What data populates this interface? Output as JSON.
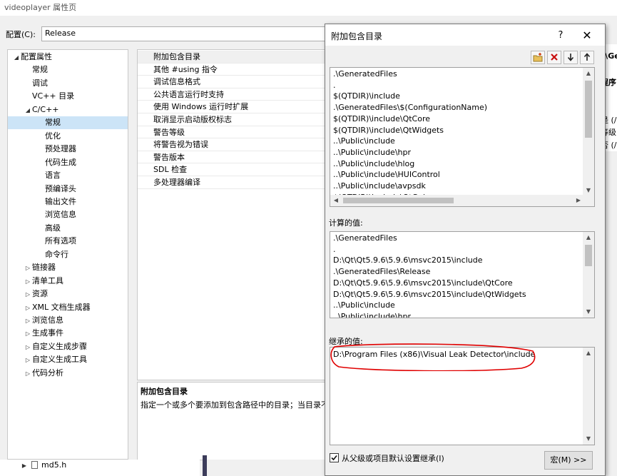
{
  "window": {
    "title": "videoplayer 属性页"
  },
  "config": {
    "label": "配置(C):",
    "value": "Release"
  },
  "tree": {
    "items": [
      {
        "label": "配置属性",
        "level": 0,
        "arrow": "down"
      },
      {
        "label": "常规",
        "level": 1
      },
      {
        "label": "调试",
        "level": 1
      },
      {
        "label": "VC++ 目录",
        "level": 1
      },
      {
        "label": "C/C++",
        "level": 1,
        "arrow": "down"
      },
      {
        "label": "常规",
        "level": 2,
        "selected": true
      },
      {
        "label": "优化",
        "level": 2
      },
      {
        "label": "预处理器",
        "level": 2
      },
      {
        "label": "代码生成",
        "level": 2
      },
      {
        "label": "语言",
        "level": 2
      },
      {
        "label": "预编译头",
        "level": 2
      },
      {
        "label": "输出文件",
        "level": 2
      },
      {
        "label": "浏览信息",
        "level": 2
      },
      {
        "label": "高级",
        "level": 2
      },
      {
        "label": "所有选项",
        "level": 2
      },
      {
        "label": "命令行",
        "level": 2
      },
      {
        "label": "链接器",
        "level": 1,
        "arrow": "right"
      },
      {
        "label": "清单工具",
        "level": 1,
        "arrow": "right"
      },
      {
        "label": "资源",
        "level": 1,
        "arrow": "right"
      },
      {
        "label": "XML 文档生成器",
        "level": 1,
        "arrow": "right"
      },
      {
        "label": "浏览信息",
        "level": 1,
        "arrow": "right"
      },
      {
        "label": "生成事件",
        "level": 1,
        "arrow": "right"
      },
      {
        "label": "自定义生成步骤",
        "level": 1,
        "arrow": "right"
      },
      {
        "label": "自定义生成工具",
        "level": 1,
        "arrow": "right"
      },
      {
        "label": "代码分析",
        "level": 1,
        "arrow": "right"
      }
    ]
  },
  "properties": [
    "附加包含目录",
    "其他 #using 指令",
    "调试信息格式",
    "公共语言运行时支持",
    "使用 Windows 运行时扩展",
    "取消显示启动版权标志",
    "警告等级",
    "将警告视为错误",
    "警告版本",
    "SDL 检查",
    "多处理器编译"
  ],
  "description": {
    "title": "附加包含目录",
    "text": "指定一个或多个要添加到包含路径中的目录；当目录不"
  },
  "right_fragments": {
    "header": ".\\Ge",
    "line1": "程序",
    "line2": "是 (/",
    "line3": "等级",
    "line4": "否 (/"
  },
  "solution": {
    "file": "md5.h"
  },
  "dialog": {
    "title": "附加包含目录",
    "help_label": "?",
    "close_label": "✕",
    "directories": [
      ".\\GeneratedFiles",
      ".",
      "$(QTDIR)\\include",
      ".\\GeneratedFiles\\$(ConfigurationName)",
      "$(QTDIR)\\include\\QtCore",
      "$(QTDIR)\\include\\QtWidgets",
      "..\\Public\\include",
      "..\\Public\\include\\hpr",
      "..\\Public\\include\\hlog",
      "..\\Public\\include\\HUIControl",
      "..\\Public\\include\\avpsdk",
      "$(QTDIR)\\include\\QtGui"
    ],
    "computed_label": "计算的值:",
    "computed": [
      ".\\GeneratedFiles",
      ".",
      "D:\\Qt\\Qt5.9.6\\5.9.6\\msvc2015\\include",
      ".\\GeneratedFiles\\Release",
      "D:\\Qt\\Qt5.9.6\\5.9.6\\msvc2015\\include\\QtCore",
      "D:\\Qt\\Qt5.9.6\\5.9.6\\msvc2015\\include\\QtWidgets",
      "..\\Public\\include",
      "..\\Public\\include\\hpr"
    ],
    "inherited_label": "继承的值:",
    "inherited": [
      "D:\\Program Files (x86)\\Visual Leak Detector\\include"
    ],
    "inherit_checkbox_label": "从父级或项目默认设置继承(I)",
    "inherit_checked": true,
    "macro_button": "宏(M) >>",
    "annotation_color": "#e00000"
  }
}
